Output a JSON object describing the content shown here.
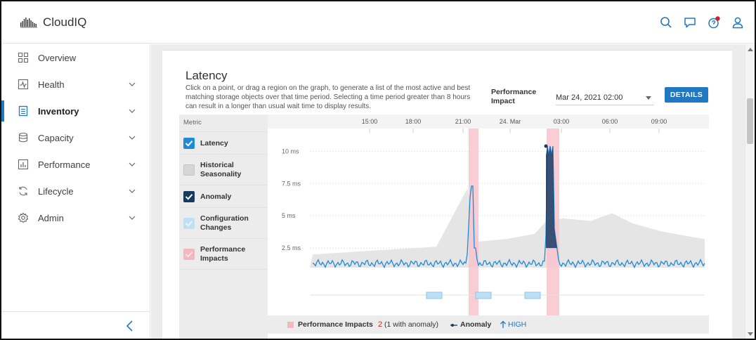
{
  "app": {
    "name": "CloudIQ"
  },
  "sidebar": {
    "items": [
      {
        "label": "Overview",
        "icon": "grid-icon",
        "active": false,
        "has_chevron": false
      },
      {
        "label": "Health",
        "icon": "health-icon",
        "active": false,
        "has_chevron": true
      },
      {
        "label": "Inventory",
        "icon": "inventory-icon",
        "active": true,
        "has_chevron": true
      },
      {
        "label": "Capacity",
        "icon": "database-icon",
        "active": false,
        "has_chevron": true
      },
      {
        "label": "Performance",
        "icon": "performance-icon",
        "active": false,
        "has_chevron": true
      },
      {
        "label": "Lifecycle",
        "icon": "lifecycle-icon",
        "active": false,
        "has_chevron": true
      },
      {
        "label": "Admin",
        "icon": "gear-icon",
        "active": false,
        "has_chevron": true
      }
    ]
  },
  "panel": {
    "title": "Latency",
    "description": "Click on a point, or drag a region on the graph, to generate a list of the most active and best matching storage objects over that time period. Selecting a time period greater than 8 hours can result in a longer than usual wait time to display results.",
    "performance_impact_label": "Performance Impact",
    "selected_time": "Mar 24, 2021 02:00",
    "details_button": "DETAILS"
  },
  "metrics": {
    "header": "Metric",
    "items": [
      {
        "label": "Latency",
        "checked": true,
        "color": "#1f8ad8"
      },
      {
        "label": "Historical Seasonality",
        "checked": false,
        "color": "#d6d6d6"
      },
      {
        "label": "Anomaly",
        "checked": true,
        "color": "#173a63"
      },
      {
        "label": "Configuration Changes",
        "checked": false,
        "color": "#bfe0f4"
      },
      {
        "label": "Performance Impacts",
        "checked": false,
        "color": "#f2b7bf"
      }
    ]
  },
  "legend": {
    "performance_impacts": "Performance Impacts",
    "count": "2",
    "count_note": "(1 with anomaly)",
    "anomaly": "Anomaly",
    "high": "HIGH"
  },
  "chart_data": {
    "type": "line",
    "x_ticks": [
      "15:00",
      "18:00",
      "21:00",
      "24. Mar",
      "03:00",
      "06:00",
      "09:00"
    ],
    "y_ticks": [
      "2.5 ms",
      "5 ms",
      "7.5 ms",
      "10 ms"
    ],
    "ylim": [
      0,
      11
    ],
    "series": [
      {
        "name": "Latency",
        "color": "#1f8ad8"
      },
      {
        "name": "Historical Seasonality",
        "color": "#d6d6d6"
      },
      {
        "name": "Anomaly",
        "color": "#173a63"
      }
    ],
    "peaks": [
      {
        "at": "21:00",
        "value": 7.3
      },
      {
        "at": "02:00",
        "value": 10.4
      }
    ],
    "baseline_value": 1.3
  }
}
